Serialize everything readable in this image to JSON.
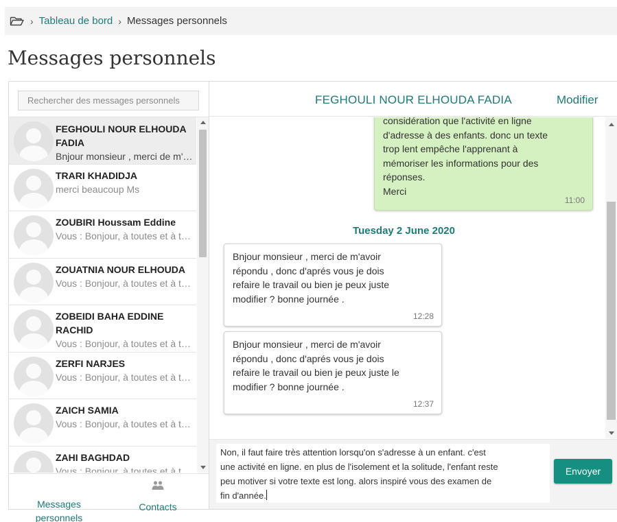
{
  "breadcrumb": {
    "home": "Tableau de bord",
    "current": "Messages personnels"
  },
  "page_title": "Messages personnels",
  "search": {
    "placeholder": "Rechercher des messages personnels"
  },
  "conversations": [
    {
      "name": "FEGHOULI NOUR ELHOUDA FADIA",
      "preview": "Bnjour monsieur , merci de m'avoir répondu"
    },
    {
      "name": "TRARI KHADIDJA",
      "preview": "merci beaucoup Ms"
    },
    {
      "name": "ZOUBIRI Houssam Eddine",
      "preview": "Vous : Bonjour, à toutes et à tous"
    },
    {
      "name": "ZOUATNIA NOUR ELHOUDA",
      "preview": "Vous : Bonjour, à toutes et à tous"
    },
    {
      "name": "ZOBEIDI BAHA EDDINE RACHID",
      "preview": "Vous : Bonjour, à toutes et à tous"
    },
    {
      "name": "ZERFI NARJES",
      "preview": "Vous : Bonjour, à toutes et à tous"
    },
    {
      "name": "ZAICH SAMIA",
      "preview": "Vous : Bonjour, à toutes et à tous"
    },
    {
      "name": "ZAHI BAGHDAD",
      "preview": "Vous : Bonjour, à toutes et à tous"
    }
  ],
  "footer": {
    "messages_label": "Messages personnels",
    "contacts_label": "Contacts"
  },
  "header": {
    "contact_name": "FEGHOULI NOUR ELHOUDA FADIA",
    "edit_label": "Modifier"
  },
  "thread": {
    "sent": {
      "lines": [
        "considération que l'activité en ligne",
        "d'adresse à des enfants. donc un texte",
        "trop lent empêche l'apprenant à",
        "mémoriser les informations pour des",
        "réponses.",
        "Merci"
      ],
      "time": "11:00"
    },
    "day_separator": "Tuesday 2 June 2020",
    "received": [
      {
        "lines": [
          "Bnjour monsieur , merci de m'avoir",
          "répondu , donc d'aprés vous je dois",
          "refaire le travail ou bien je peux juste",
          "modifier ? bonne journée ."
        ],
        "time": "12:28"
      },
      {
        "lines": [
          "Bnjour monsieur , merci de m'avoir",
          "répondu , donc d'aprés vous je dois",
          "refaire le travail ou bien je peux juste le",
          "modifier ? bonne journée ."
        ],
        "time": "12:37"
      }
    ]
  },
  "compose": {
    "lines": [
      "Non, il faut faire très attention lorsqu'on s'adresse à un enfant. c'est",
      "une activité en ligne. en plus de l'isolement et la solitude, l'enfant reste",
      "peu motiver si  votre texte est long. alors inspiré vous des examen de",
      "fin d'année."
    ],
    "send_label": "Envoyer"
  },
  "colors": {
    "accent": "#1f7a78",
    "send_button": "#148f80",
    "sent_bubble": "#d5f0c1",
    "selected_row": "#ededed"
  },
  "icons": {
    "breadcrumb": "folder-open-icon",
    "contacts": "users-icon"
  }
}
